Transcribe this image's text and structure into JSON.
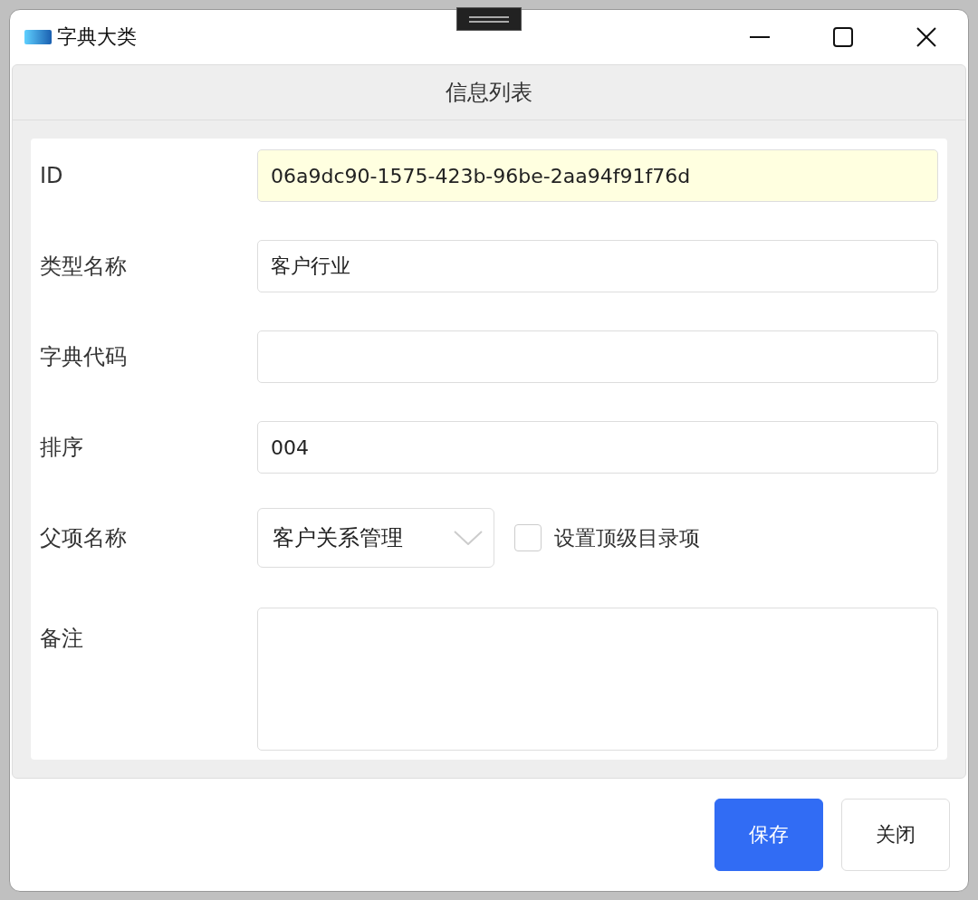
{
  "window": {
    "title": "字典大类"
  },
  "panel": {
    "title": "信息列表"
  },
  "fields": [
    {
      "kind": "text",
      "label": "ID",
      "value": "06a9dc90-1575-423b-96be-2aa94f91f76d",
      "readonly": true
    },
    {
      "kind": "text",
      "label": "类型名称",
      "value": "客户行业",
      "readonly": false
    },
    {
      "kind": "text",
      "label": "字典代码",
      "readonly": false
    },
    {
      "kind": "text",
      "label": "排序",
      "value": "004",
      "readonly": false
    },
    {
      "kind": "select",
      "label": "父项名称",
      "value": "客户关系管理",
      "checkbox": {
        "label": "设置顶级目录项",
        "checked": false
      }
    },
    {
      "kind": "textarea",
      "label": "备注"
    }
  ],
  "buttons": [
    {
      "label": "保存",
      "primary": true
    },
    {
      "label": "关闭",
      "primary": false
    }
  ]
}
